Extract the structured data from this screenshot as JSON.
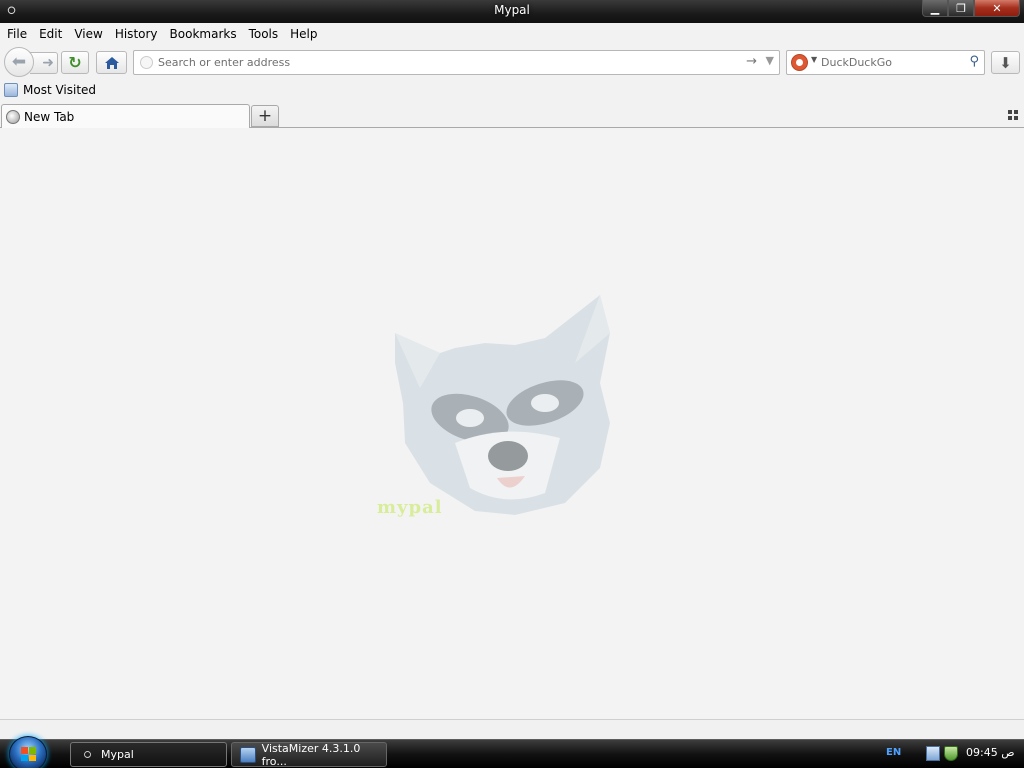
{
  "window": {
    "title": "Mypal"
  },
  "menu": [
    "File",
    "Edit",
    "View",
    "History",
    "Bookmarks",
    "Tools",
    "Help"
  ],
  "navbar": {
    "url_placeholder": "Search or enter address",
    "search_placeholder": "DuckDuckGo"
  },
  "bookmarks": [
    {
      "label": "Most Visited"
    }
  ],
  "tabs": [
    {
      "label": "New Tab"
    }
  ],
  "content": {
    "logo_text": "mypal"
  },
  "taskbar": {
    "tasks": [
      {
        "label": "Mypal"
      },
      {
        "label": "VistaMizer 4.3.1.0 fro..."
      }
    ],
    "language": "EN",
    "clock": "09:45 ص"
  }
}
